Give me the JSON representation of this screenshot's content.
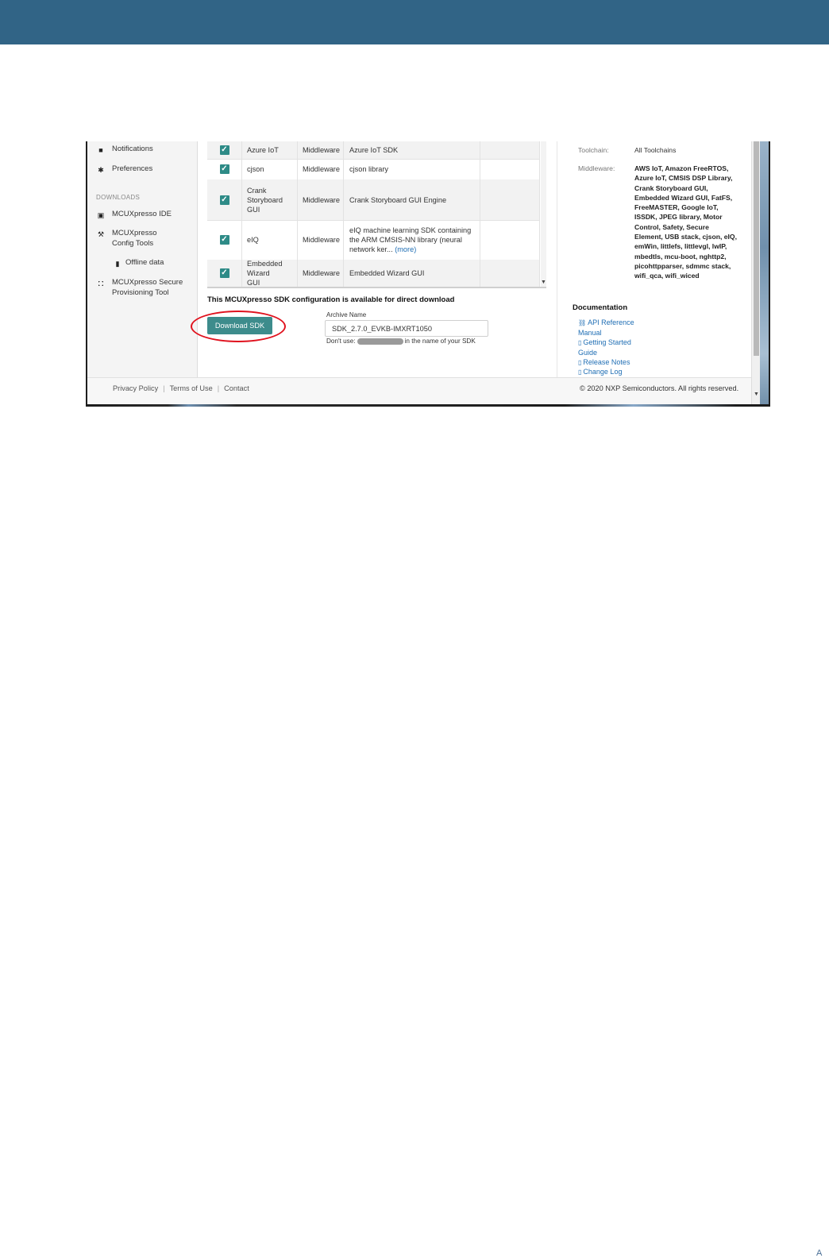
{
  "sidebar": {
    "items": [
      {
        "icon": "bell-icon",
        "glyph": "🔔",
        "label": "Notifications"
      },
      {
        "icon": "gear-icon",
        "glyph": "⚙",
        "label": "Preferences"
      }
    ],
    "downloads_heading": "DOWNLOADS",
    "downloads": [
      {
        "icon": "ide-icon",
        "glyph": "▣",
        "label": "MCUXpresso IDE"
      },
      {
        "icon": "tools-icon",
        "glyph": "⚒",
        "label": "MCUXpresso Config Tools"
      },
      {
        "icon": "file-icon",
        "glyph": "▮",
        "label": "Offline data"
      },
      {
        "icon": "shield-icon",
        "glyph": "⛊",
        "label": "MCUXpresso Secure Provisioning Tool"
      }
    ]
  },
  "table": {
    "rows": [
      {
        "checked": true,
        "name": "Azure IoT",
        "type": "Middleware",
        "description": "Azure IoT SDK"
      },
      {
        "checked": true,
        "name": "cjson",
        "type": "Middleware",
        "description": "cjson library"
      },
      {
        "checked": true,
        "name": "Crank Storyboard GUI",
        "type": "Middleware",
        "description": "Crank Storyboard GUI Engine"
      },
      {
        "checked": true,
        "name": "eIQ",
        "type": "Middleware",
        "description": "eIQ machine learning SDK containing the ARM CMSIS-NN library (neural network ker...",
        "more": "(more)"
      },
      {
        "checked": true,
        "name": "Embedded Wizard GUI",
        "type": "Middleware",
        "description": "Embedded Wizard GUI"
      }
    ]
  },
  "download": {
    "availability_text": "This MCUXpresso SDK configuration is available for direct download",
    "button_label": "Download SDK",
    "archive_label": "Archive Name",
    "archive_value": "SDK_2.7.0_EVKB-IMXRT1050",
    "dont_use_prefix": "Don't use:",
    "dont_use_suffix": "in the name of your SDK"
  },
  "details": {
    "toolchain_label": "Toolchain:",
    "toolchain_value": "All Toolchains",
    "middleware_label": "Middleware:",
    "middleware_value": "AWS IoT, Amazon FreeRTOS, Azure IoT, CMSIS DSP Library, Crank Storyboard GUI, Embedded Wizard GUI, FatFS, FreeMASTER, Google IoT, ISSDK, JPEG library, Motor Control, Safety, Secure Element, USB stack, cjson, eIQ, emWin, littlefs, littlevgl, lwIP, mbedtls, mcu-boot, nghttp2, picohttpparser, sdmmc stack, wifi_qca, wifi_wiced",
    "documentation_heading": "Documentation",
    "docs": [
      {
        "icon": "link-icon",
        "glyph": "🔗",
        "label": "API Reference Manual"
      },
      {
        "icon": "document-icon",
        "glyph": "🗎",
        "label": "Getting Started Guide"
      },
      {
        "icon": "document-icon",
        "glyph": "🗎",
        "label": "Release Notes"
      },
      {
        "icon": "document-icon",
        "glyph": "🗎",
        "label": "Change Log"
      }
    ]
  },
  "footer": {
    "links": [
      "Privacy Policy",
      "Terms of Use",
      "Contact"
    ],
    "copyright": "© 2020 NXP Semiconductors. All rights reserved."
  },
  "page_mark": "A",
  "colors": {
    "header": "#316486",
    "accent": "#3d8c8c",
    "highlight": "#e0121e",
    "link": "#1f6eb4"
  }
}
